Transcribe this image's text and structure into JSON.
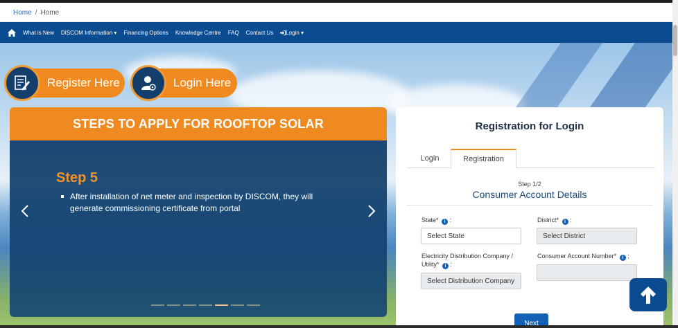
{
  "breadcrumb": {
    "home": "Home",
    "separator": "/",
    "current": "Home"
  },
  "nav": {
    "home_icon": "home-icon",
    "items": [
      {
        "label": "What is New"
      },
      {
        "label": "DISCOM Information ▾"
      },
      {
        "label": "Financing Options"
      },
      {
        "label": "Knowledge Centre"
      },
      {
        "label": "FAQ"
      },
      {
        "label": "Contact Us"
      },
      {
        "label": "Login ▾",
        "icon": "sign-in-icon"
      }
    ]
  },
  "cta": {
    "register": {
      "label": "Register Here",
      "icon": "register-form-icon"
    },
    "login": {
      "label": "Login Here",
      "icon": "user-login-icon"
    }
  },
  "steps": {
    "header": "STEPS TO APPLY FOR ROOFTOP SOLAR",
    "step_title": "Step 5",
    "step_text": "After installation of net meter and inspection by DISCOM, they will generate commissioning certificate from portal",
    "prev_icon": "chevron-left-icon",
    "next_icon": "chevron-right-icon",
    "total_slides": 7,
    "active_slide": 5
  },
  "registration": {
    "title": "Registration for Login",
    "tabs": [
      {
        "label": "Login"
      },
      {
        "label": "Registration"
      }
    ],
    "active_tab": "Registration",
    "step_label": "Step 1/2",
    "section_title": "Consumer Account Details",
    "fields": {
      "state_label": "State* ",
      "state_placeholder": "Select State",
      "district_label": "District* ",
      "district_placeholder": "Select District",
      "discom_label_line1": "Electricity Distribution Company /",
      "discom_label_line2": "Utility* ",
      "discom_placeholder": "Select Distribution Company",
      "account_label": "Consumer Account Number* ",
      "account_value": ""
    },
    "next_label": "Next"
  },
  "colors": {
    "navy": "#0b4b8f",
    "orange": "#ef8a21",
    "link": "#2a6fba"
  },
  "scroll_top_icon": "arrow-up-icon"
}
